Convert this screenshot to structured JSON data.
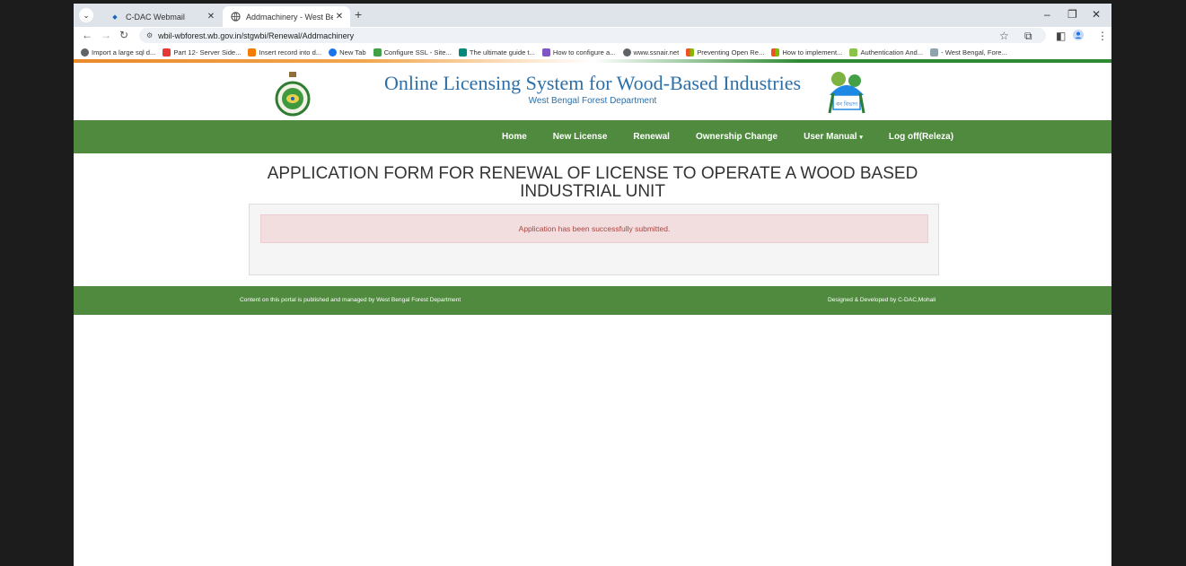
{
  "browser": {
    "tabs": [
      {
        "title": "C-DAC Webmail",
        "active": false
      },
      {
        "title": "Addmachinery - West Bengal, F",
        "active": true
      }
    ],
    "url": "wbil-wbforest.wb.gov.in/stgwbi/Renewal/Addmachinery",
    "bookmarks": [
      {
        "label": "Import a large sql d...",
        "color": "#5f6368"
      },
      {
        "label": "Part 12- Server Side...",
        "color": "#e53935"
      },
      {
        "label": "Insert record into d...",
        "color": "#f57c00"
      },
      {
        "label": "New Tab",
        "color": "#1a73e8"
      },
      {
        "label": "Configure SSL - Site...",
        "color": "#43a047"
      },
      {
        "label": "The ultimate guide t...",
        "color": "#00897b"
      },
      {
        "label": "How to configure a...",
        "color": "#7e57c2"
      },
      {
        "label": "www.ssnair.net",
        "color": "#5f6368"
      },
      {
        "label": "Preventing Open Re...",
        "color": "#f25022"
      },
      {
        "label": "How to implement...",
        "color": "#f25022"
      },
      {
        "label": "Authentication And...",
        "color": "#8bc34a"
      },
      {
        "label": "- West Bengal, Fore...",
        "color": "#90a4ae"
      }
    ]
  },
  "site": {
    "title": "Online Licensing System for Wood-Based Industries",
    "subtitle": "West Bengal Forest Department",
    "logo_text": "বন বিভাগ"
  },
  "nav": {
    "home": "Home",
    "new_license": "New License",
    "renewal": "Renewal",
    "ownership_change": "Ownership Change",
    "user_manual": "User Manual",
    "logoff": "Log off(Releza)"
  },
  "form": {
    "title_line1": "APPLICATION FORM FOR RENEWAL OF LICENSE TO OPERATE A WOOD BASED",
    "title_line2": "INDUSTRIAL UNIT",
    "alert": "Application has been successfully submitted."
  },
  "footer": {
    "left": "Content on this portal is published and managed by West Bengal Forest Department",
    "right": "Designed & Developed by C-DAC,Mohali"
  },
  "colors": {
    "nav_green": "#4f8a3e",
    "title_blue": "#2c6fa8",
    "alert_text": "#a94442",
    "alert_bg": "#f2dede"
  }
}
